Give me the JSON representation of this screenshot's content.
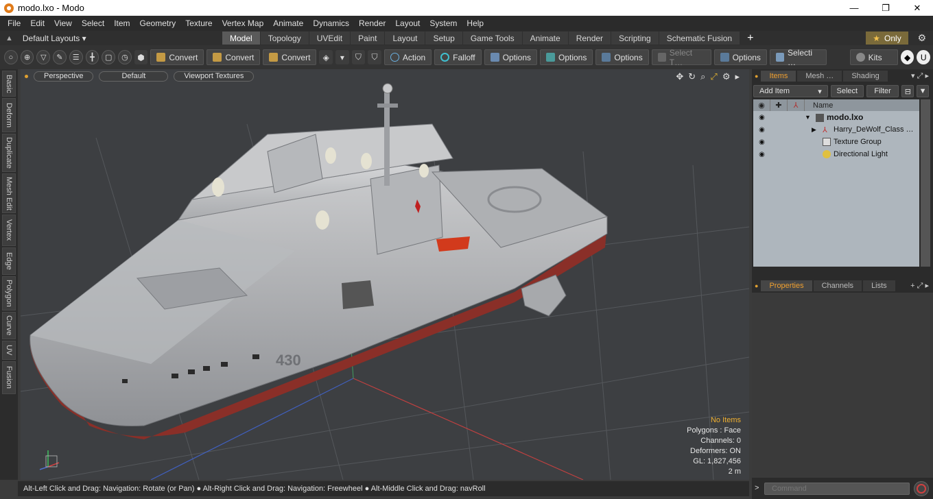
{
  "window": {
    "title": "modo.lxo - Modo",
    "min": "—",
    "max": "❐",
    "close": "✕"
  },
  "menu": [
    "File",
    "Edit",
    "View",
    "Select",
    "Item",
    "Geometry",
    "Texture",
    "Vertex Map",
    "Animate",
    "Dynamics",
    "Render",
    "Layout",
    "System",
    "Help"
  ],
  "layouts": {
    "label": "Default Layouts ▾"
  },
  "tabs": [
    "Model",
    "Topology",
    "UVEdit",
    "Paint",
    "Layout",
    "Setup",
    "Game Tools",
    "Animate",
    "Render",
    "Scripting",
    "Schematic Fusion"
  ],
  "only_label": "Only",
  "toolbar": {
    "convert1": "Convert",
    "convert2": "Convert",
    "convert3": "Convert",
    "action": "Action",
    "falloff": "Falloff",
    "options1": "Options",
    "options2": "Options",
    "options3": "Options",
    "options4": "Options",
    "select_t": "Select T…",
    "selecti": "Selecti …",
    "kits": "Kits"
  },
  "left_tabs": [
    "Basic",
    "Deform",
    "Duplicate",
    "Mesh Edit",
    "Vertex",
    "Edge",
    "Polygon",
    "Curve",
    "UV",
    "Fusion"
  ],
  "viewport": {
    "perspective": "Perspective",
    "default": "Default",
    "textures": "Viewport Textures",
    "hull_number": "430",
    "stats": {
      "no_items": "No Items",
      "polygons": "Polygons : Face",
      "channels": "Channels: 0",
      "deformers": "Deformers: ON",
      "gl": "GL: 1,827,456",
      "scale": "2 m"
    }
  },
  "status": "Alt-Left Click and Drag: Navigation: Rotate (or Pan) ● Alt-Right Click and Drag: Navigation: Freewheel ● Alt-Middle Click and Drag: navRoll",
  "items_panel": {
    "tabs": [
      "Items",
      "Mesh …",
      "Shading"
    ],
    "add_item": "Add Item",
    "select": "Select",
    "filter": "Filter",
    "name_header": "Name",
    "rows": [
      {
        "label": "modo.lxo"
      },
      {
        "label": "Harry_DeWolf_Class …"
      },
      {
        "label": "Texture Group"
      },
      {
        "label": "Directional Light"
      }
    ]
  },
  "props_panel": {
    "tabs": [
      "Properties",
      "Channels",
      "Lists"
    ]
  },
  "command": {
    "placeholder": "Command"
  }
}
